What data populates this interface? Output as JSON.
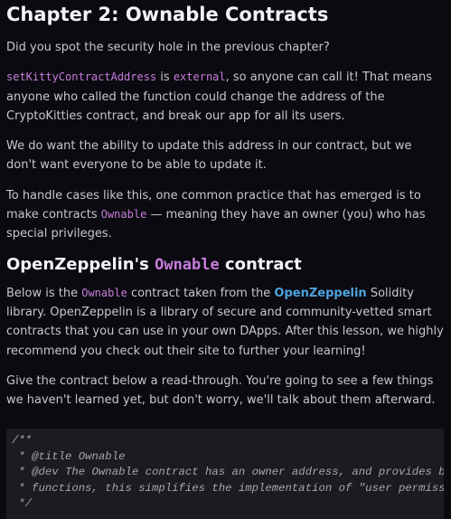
{
  "title": "Chapter 2: Ownable Contracts",
  "p1": "Did you spot the security hole in the previous chapter?",
  "p2": {
    "code1": "setKittyContractAddress",
    "t1": " is ",
    "code2": "external",
    "t2": ", so anyone can call it! That means anyone who called the function could change the address of the CryptoKitties contract, and break our app for all its users."
  },
  "p3": "We do want the ability to update this address in our contract, but we don't want everyone to be able to update it.",
  "p4": {
    "t1": "To handle cases like this, one common practice that has emerged is to make contracts ",
    "code": "Ownable",
    "t2": " — meaning they have an owner (you) who has special privileges."
  },
  "h2": {
    "t1": "OpenZeppelin's ",
    "code": "Ownable",
    "t2": " contract"
  },
  "p5": {
    "t1": "Below is the ",
    "code": "Ownable",
    "t2": " contract taken from the ",
    "link": "OpenZeppelin",
    "t3": " Solidity library. OpenZeppelin is a library of secure and community-vetted smart contracts that you can use in your own DApps. After this lesson, we highly recommend you check out their site to further your learning!"
  },
  "p6": "Give the contract below a read-through. You're going to see a few things we haven't learned yet, but don't worry, we'll talk about them afterward.",
  "code_lines": [
    "/**",
    " * @title Ownable",
    " * @dev The Ownable contract has an owner address, and provides basic authorization control",
    " * functions, this simplifies the implementation of \"user permissions\".",
    " */"
  ]
}
